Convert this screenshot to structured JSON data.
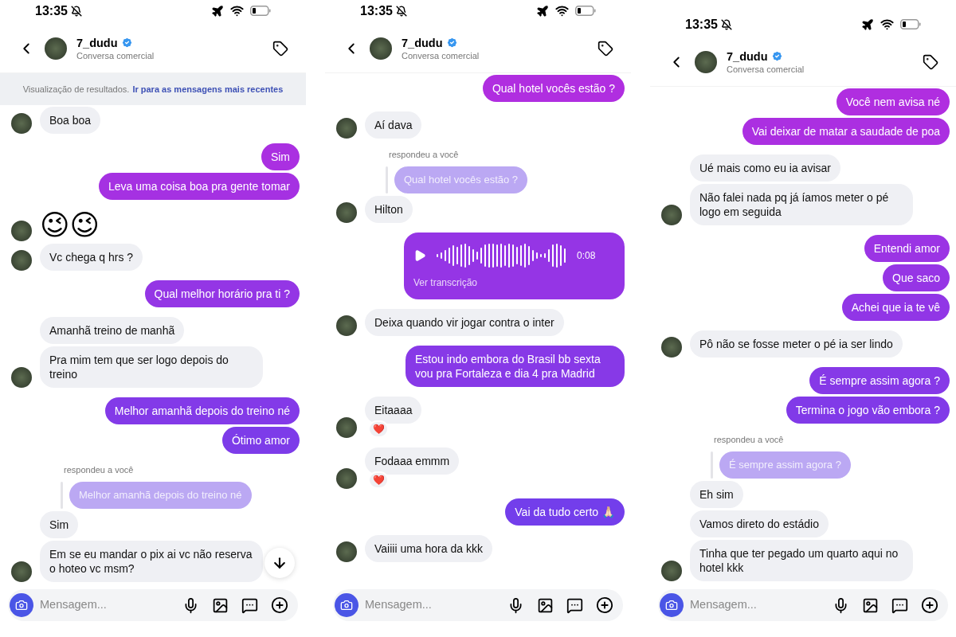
{
  "screens": [
    {
      "status": {
        "time": "13:35"
      },
      "header": {
        "name": "7_dudu",
        "subtitle": "Conversa comercial"
      },
      "banner": {
        "text": "Visualização de resultados.",
        "link": "Ir para as mensagens mais recentes"
      },
      "messages": [
        {
          "kind": "received",
          "text": "Boa boa",
          "avatar": true
        },
        {
          "kind": "sent",
          "text": "Sim"
        },
        {
          "kind": "sent",
          "text": "Leva uma coisa boa pra gente tomar"
        },
        {
          "kind": "emoji",
          "text": "😉😉",
          "avatar": true
        },
        {
          "kind": "received",
          "text": "Vc chega q hrs ?",
          "avatar": true
        },
        {
          "kind": "sent",
          "text": "Qual melhor horário pra ti ?"
        },
        {
          "kind": "received",
          "text": "Amanhã treino de manhã",
          "avatar": false
        },
        {
          "kind": "received",
          "text": "Pra mim tem que ser logo depois do treino",
          "avatar": true
        },
        {
          "kind": "sent",
          "text": "Melhor amanhã depois do treino né"
        },
        {
          "kind": "sent",
          "text": "Ótimo amor"
        },
        {
          "kind": "reply",
          "label": "respondeu a você",
          "text": "Melhor amanhã depois do treino né"
        },
        {
          "kind": "received",
          "text": "Sim",
          "avatar": false
        },
        {
          "kind": "received",
          "text": "Em se eu mandar o pix ai vc não reserva o hoteo vc msm?",
          "avatar": true
        }
      ],
      "jump_button": true,
      "composer": {
        "placeholder": "Mensagem..."
      }
    },
    {
      "status": {
        "time": "13:35"
      },
      "header": {
        "name": "7_dudu",
        "subtitle": "Conversa comercial"
      },
      "messages": [
        {
          "kind": "sent",
          "text": "Qual hotel vocês estão ?"
        },
        {
          "kind": "received",
          "text": "Aí dava",
          "avatar": true
        },
        {
          "kind": "reply",
          "label": "respondeu a você",
          "text": "Qual hotel vocês estão ?"
        },
        {
          "kind": "received",
          "text": "Hilton",
          "avatar": true
        },
        {
          "kind": "voice",
          "duration": "0:08",
          "link": "Ver transcrição"
        },
        {
          "kind": "received",
          "text": "Deixa quando vir jogar contra o inter",
          "avatar": true
        },
        {
          "kind": "sent",
          "text": "Estou indo embora do Brasil bb sexta vou pra Fortaleza e dia 4 pra Madrid"
        },
        {
          "kind": "received",
          "text": "Eitaaaa",
          "avatar": true,
          "reaction": "❤️"
        },
        {
          "kind": "received",
          "text": "Fodaaa emmm",
          "avatar": true,
          "reaction": "❤️"
        },
        {
          "kind": "sent",
          "text": "Vai da tudo certo 🙏🏻"
        },
        {
          "kind": "received",
          "text": "Vaiiii uma hora da kkk",
          "avatar": true
        }
      ],
      "jump_button": false,
      "composer": {
        "placeholder": "Mensagem..."
      }
    },
    {
      "status": {
        "time": "13:35"
      },
      "header": {
        "name": "7_dudu",
        "subtitle": "Conversa comercial"
      },
      "messages": [
        {
          "kind": "sent",
          "text": "Você nem avisa né"
        },
        {
          "kind": "sent",
          "text": "Vai deixar de matar a saudade de poa"
        },
        {
          "kind": "received",
          "text": "Ué mais como eu ia avisar",
          "avatar": false
        },
        {
          "kind": "received",
          "text": "Não falei nada pq já íamos meter o pé logo em seguida",
          "avatar": true
        },
        {
          "kind": "sent",
          "text": "Entendi amor"
        },
        {
          "kind": "sent",
          "text": "Que saco"
        },
        {
          "kind": "sent",
          "text": "Achei que ia te vê"
        },
        {
          "kind": "received",
          "text": "Pô não se fosse meter o pé ia ser lindo",
          "avatar": true
        },
        {
          "kind": "sent",
          "text": "É sempre assim agora ?"
        },
        {
          "kind": "sent",
          "text": "Termina o jogo vão embora ?"
        },
        {
          "kind": "reply",
          "label": "respondeu a você",
          "text": "É sempre assim agora ?"
        },
        {
          "kind": "received",
          "text": "Eh sim",
          "avatar": false
        },
        {
          "kind": "received",
          "text": "Vamos direto do estádio",
          "avatar": false
        },
        {
          "kind": "received",
          "text": "Tinha que ter pegado um quarto aqui no hotel kkk",
          "avatar": true
        }
      ],
      "jump_button": false,
      "composer": {
        "placeholder": "Mensagem..."
      }
    }
  ]
}
